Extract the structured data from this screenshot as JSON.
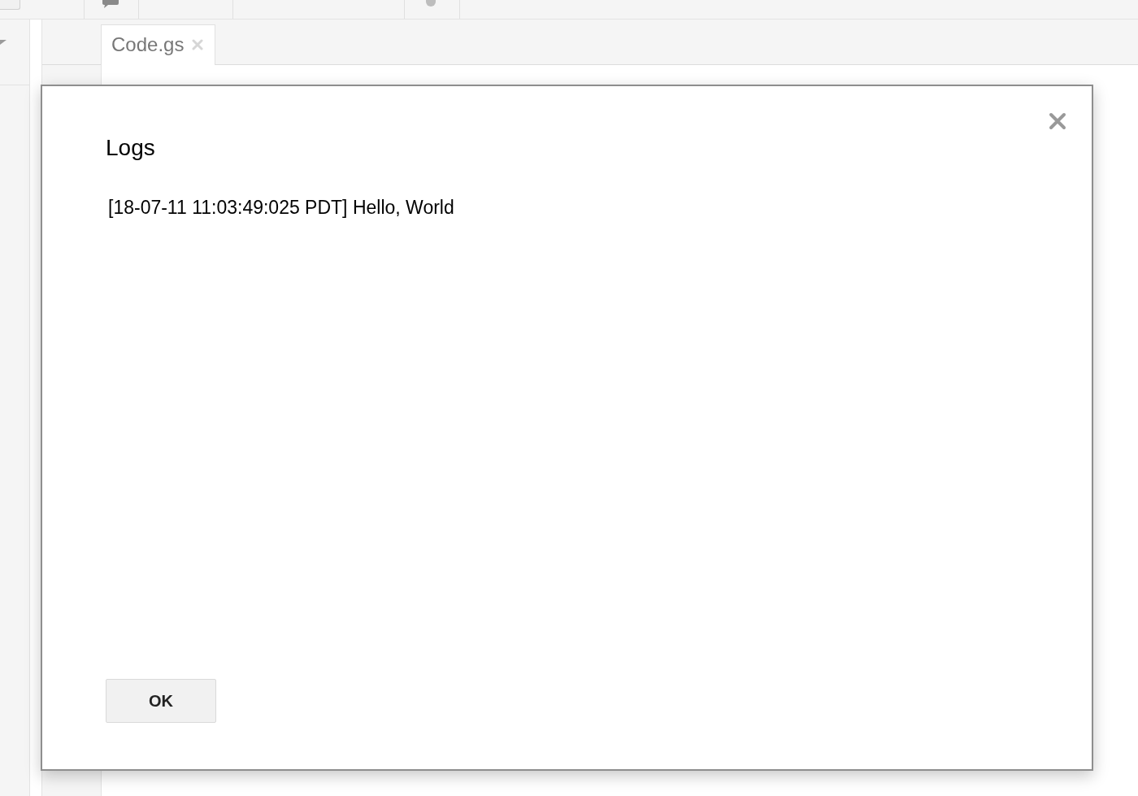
{
  "editor": {
    "tabs": [
      {
        "label": "Code.gs",
        "selected": true
      }
    ]
  },
  "dialog": {
    "title": "Logs",
    "log_lines": [
      "[18-07-11 11:03:49:025 PDT] Hello, World"
    ],
    "buttons": [
      "OK"
    ]
  }
}
